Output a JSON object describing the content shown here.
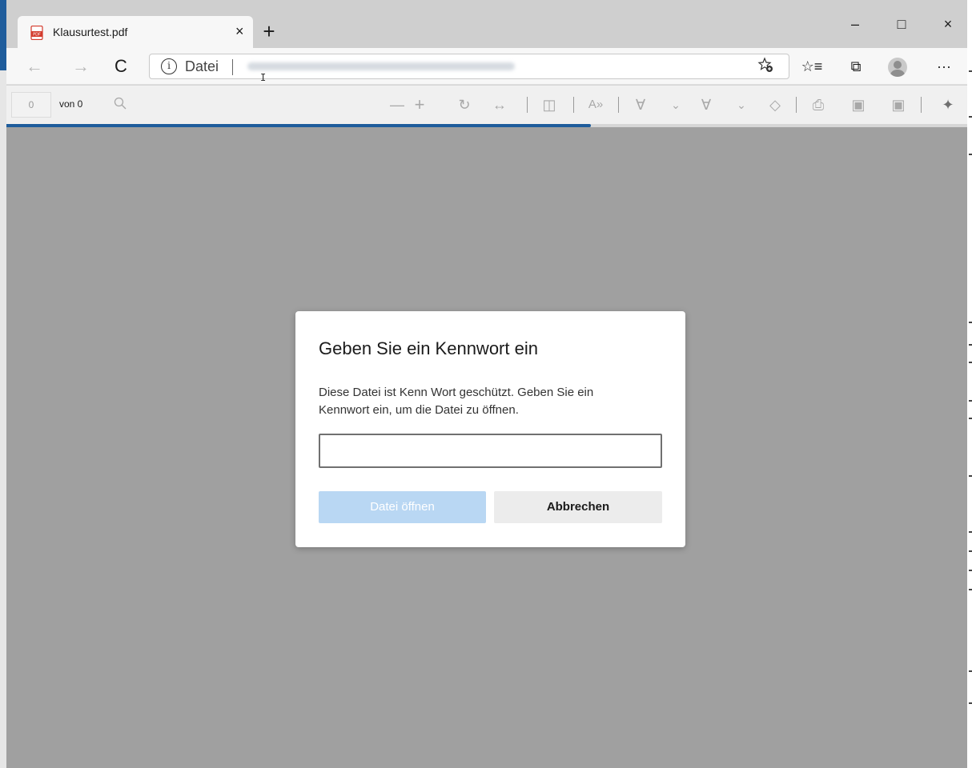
{
  "tab": {
    "title": "Klausurtest.pdf",
    "close_glyph": "×",
    "icon": "pdf-file-icon"
  },
  "new_tab_glyph": "+",
  "window_controls": {
    "minimize": "–",
    "maximize": "□",
    "close": "×"
  },
  "nav": {
    "back": "←",
    "forward": "→",
    "refresh": "C"
  },
  "address": {
    "info_glyph": "i",
    "scheme": "Datei",
    "favorite_icon": "add-favorite-icon"
  },
  "toolbar_icons": {
    "favorites": "☆≡",
    "collections": "⧉",
    "more": "···"
  },
  "pdf_toolbar": {
    "page_value": "0",
    "page_count": "von 0",
    "zoom_out": "—",
    "zoom_in": "+",
    "rotate": "↻",
    "fit": "↔",
    "two_page": "◫",
    "read_aloud": "A»",
    "draw": "∀",
    "highlight": "∀",
    "chevron": "⌄",
    "erase": "◇",
    "print": "⎙",
    "save": "▣",
    "save_as": "▣",
    "pin": "✦"
  },
  "dialog": {
    "title": "Geben Sie ein Kennwort ein",
    "message": "Diese Datei ist Kenn Wort geschützt. Geben Sie ein Kennwort ein, um die Datei zu öffnen.",
    "password_value": "",
    "open_label": "Datei öffnen",
    "cancel_label": "Abbrechen"
  },
  "colors": {
    "accent": "#1f5d9c",
    "overlay": "#a0a0a0",
    "primary_disabled": "#b9d7f3"
  }
}
